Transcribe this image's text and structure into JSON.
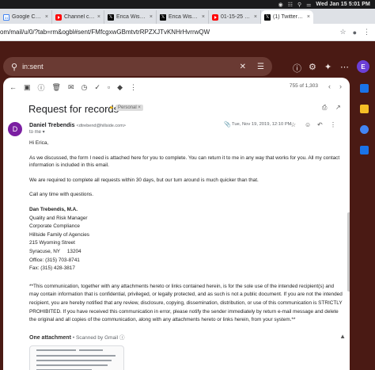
{
  "menubar": {
    "clock": "Wed Jan 15  5:01 PM"
  },
  "tabs": [
    {
      "title": "Google Calen",
      "favicon": "google-calendar"
    },
    {
      "title": "Channel cont",
      "favicon": "youtube"
    },
    {
      "title": "Erica Wissick",
      "favicon": "x"
    },
    {
      "title": "Erica Wissick",
      "favicon": "x"
    },
    {
      "title": "01-15-25 - Yo",
      "favicon": "youtube"
    },
    {
      "title": "(1) Twitter on",
      "favicon": "x"
    }
  ],
  "address": {
    "url": "om/mail/u/0/?tab=rm&ogbl#sent/FMfcgxwGBmtvtrRPZXJTvKNHrHvrrwQW"
  },
  "search": {
    "query": "in:sent"
  },
  "header": {
    "avatar_letter": "E",
    "avatar_color": "#6b3fd6"
  },
  "toolbar": {
    "counter": "755 of 1,303"
  },
  "message": {
    "subject": "Request for records",
    "label": "Personal ×",
    "sender_initial": "D",
    "sender_name": "Daniel Trebendis",
    "sender_email": "<dtrebend@hillside.com>",
    "to": "to me ▾",
    "datetime": "Tue, Nov 19, 2019, 12:10 PM",
    "greeting": "Hi Erica,",
    "para1": "As we discussed, the form I need is attached here for you to complete. You can return it to me in any way that works for you. All my contact information is included in this email.",
    "para2": "We are required to complete all requests within 30 days, but our turn around is much quicker than that.",
    "para3": "Call any time with questions.",
    "signature": [
      "Dan Trebendis, M.A.",
      "Quality and Risk Manager",
      "Corporate Compliance",
      "Hillside Family of Agencies",
      "215 Wyoming Street",
      "Syracuse, NY     13204",
      "Office: (315) 703-8741",
      "Fax: (315) 428-3817"
    ],
    "notice": "**This communication, together with any attachments hereto or links contained herein, is for the sole use of the intended recipient(s) and may contain information that is confidential, privileged, or legally protected, and as such is not a public document. If you are not the intended recipient, you are hereby notified that any review, disclosure, copying, dissemination, distribution, or use of this communication is STRICTLY PROHIBITED. If you have received this communication in error, please notify the sender immediately by return e-mail message and delete the original and all copies of the communication, along with any attachments hereto or links herein, from your system.**"
  },
  "attachments": {
    "title": "One attachment",
    "scanned": "•  Scanned by Gmail",
    "scanned_icon": "info-icon"
  }
}
